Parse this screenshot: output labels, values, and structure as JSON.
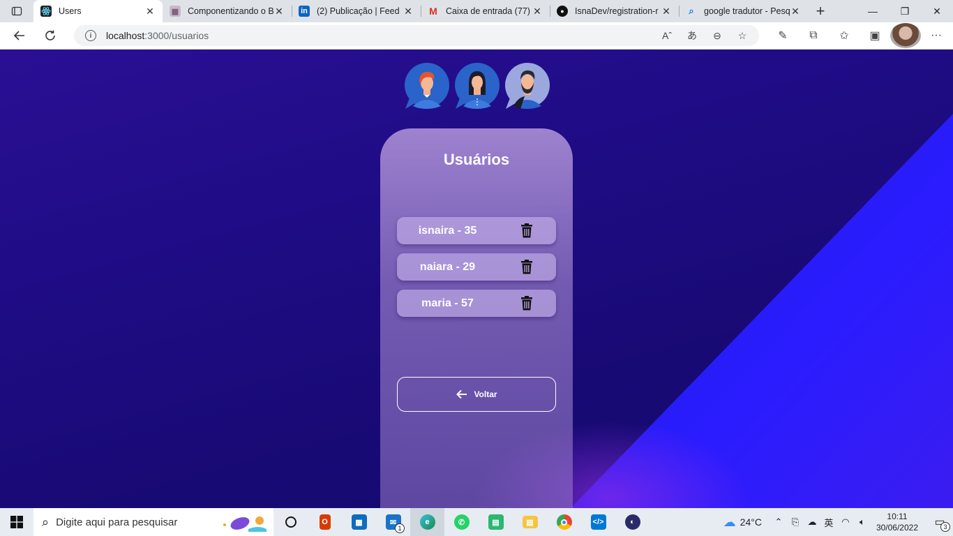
{
  "browser": {
    "tabs": [
      {
        "title": "Users",
        "active": true,
        "favicon": "react-icon"
      },
      {
        "title": "Componentizando o B",
        "active": false,
        "favicon": "doc-icon"
      },
      {
        "title": "(2) Publicação | Feed |",
        "active": false,
        "favicon": "linkedin-icon"
      },
      {
        "title": "Caixa de entrada (77)",
        "active": false,
        "favicon": "gmail-icon"
      },
      {
        "title": "IsnaDev/registration-r",
        "active": false,
        "favicon": "github-icon"
      },
      {
        "title": "google tradutor - Pesq",
        "active": false,
        "favicon": "search-icon"
      }
    ],
    "address": {
      "host": "localhost",
      "path": ":3000/usuarios"
    }
  },
  "page": {
    "title": "Usuários",
    "users": [
      {
        "label": "isnaira - 35"
      },
      {
        "label": "naiara - 29"
      },
      {
        "label": "maria - 57"
      }
    ],
    "back_label": "Voltar"
  },
  "taskbar": {
    "search_placeholder": "Digite aqui para pesquisar",
    "mail_badge": "1",
    "temperature": "24°C",
    "time": "10:11",
    "date": "30/06/2022",
    "notifications": "3"
  },
  "colors": {
    "background": "#1f0c85",
    "accent_diagonal": "#2a1cff",
    "card": "#b49be0"
  }
}
